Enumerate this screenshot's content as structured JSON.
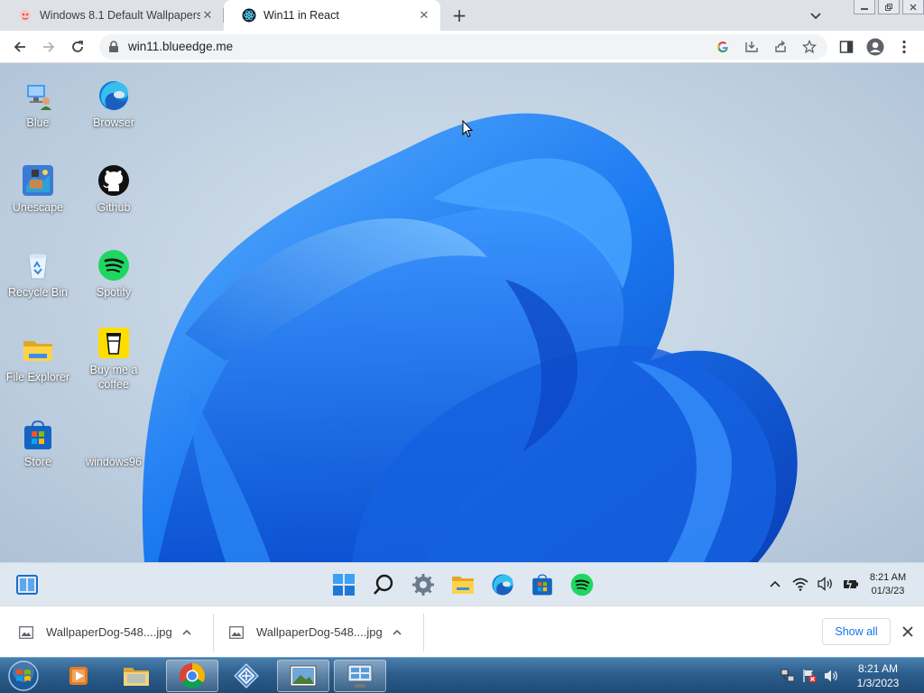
{
  "browser": {
    "tabs": [
      {
        "title": "Windows 8.1 Default Wallpapers",
        "close": "✕"
      },
      {
        "title": "Win11 in React",
        "close": "✕"
      }
    ],
    "new_tab": "+",
    "address": "win11.blueedge.me"
  },
  "desktop": {
    "icons": [
      {
        "label": "Blue"
      },
      {
        "label": "Browser"
      },
      {
        "label": "Unescape"
      },
      {
        "label": "Github"
      },
      {
        "label": "Recycle Bin"
      },
      {
        "label": "Spotify"
      },
      {
        "label": "File Explorer"
      },
      {
        "label": "Buy me a coffee"
      },
      {
        "label": "Store"
      },
      {
        "label": "windows96"
      }
    ]
  },
  "win11_taskbar": {
    "time": "8:21 AM",
    "date": "01/3/23"
  },
  "downloads": {
    "items": [
      {
        "name": "WallpaperDog-548....jpg"
      },
      {
        "name": "WallpaperDog-548....jpg"
      }
    ],
    "show_all": "Show all"
  },
  "win7_taskbar": {
    "time": "8:21 AM",
    "date": "1/3/2023"
  },
  "colors": {
    "accent_blue": "#1a73e8",
    "bloom_blue": "#1565e0",
    "spotify_green": "#1ed760"
  }
}
